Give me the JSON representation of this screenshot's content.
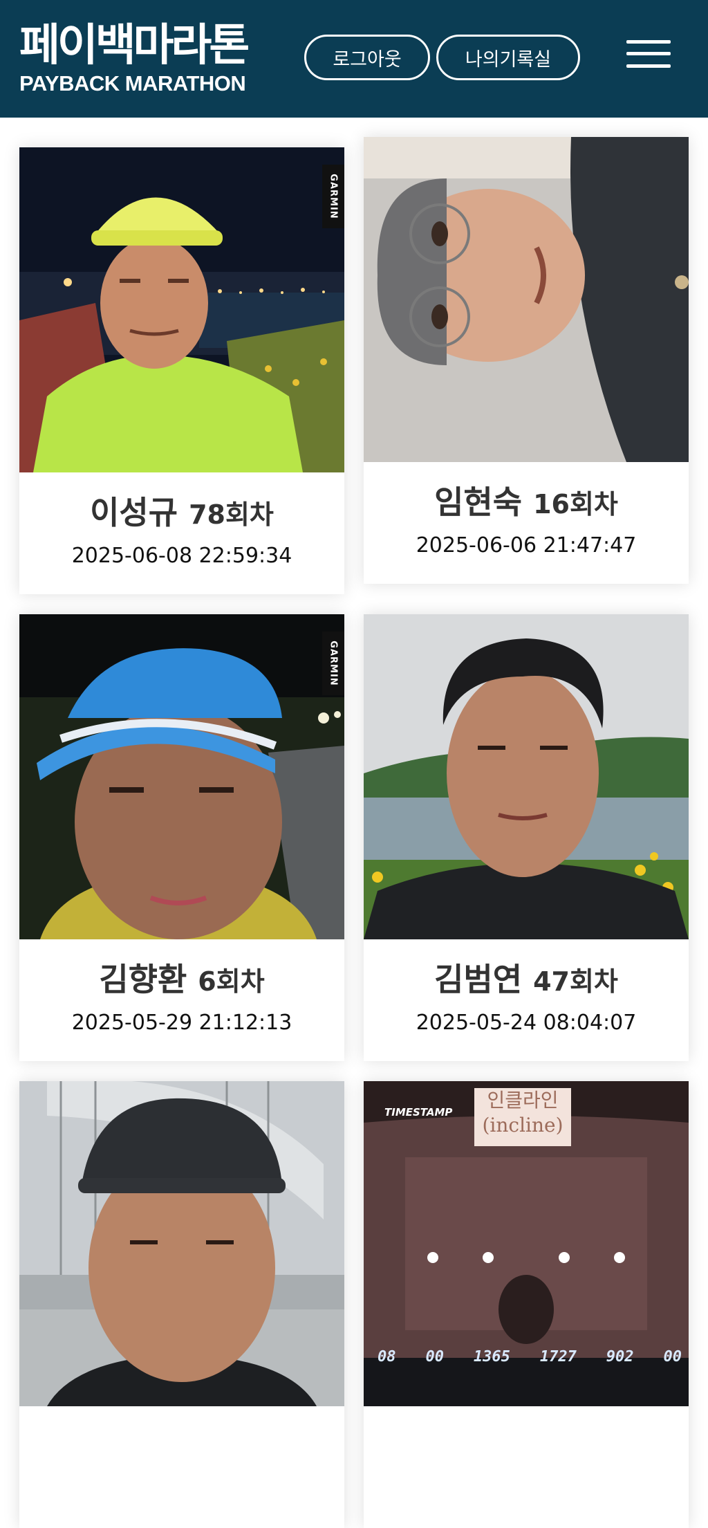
{
  "header": {
    "logo_kr": "페이백마라톤",
    "logo_en": "PAYBACK MARATHON",
    "logout_label": "로그아웃",
    "records_label": "나의기록실",
    "menu_icon": "hamburger-menu-icon",
    "background_color": "#0b3d54"
  },
  "cards": [
    {
      "name": "이성규",
      "round": "78회차",
      "date": "2025-06-08 22:59:34",
      "photo_badge": "GARMIN"
    },
    {
      "name": "임현숙",
      "round": "16회차",
      "date": "2025-06-06 21:47:47"
    },
    {
      "name": "김향환",
      "round": "6회차",
      "date": "2025-05-29 21:12:13",
      "photo_badge": "GARMIN"
    },
    {
      "name": "김범연",
      "round": "47회차",
      "date": "2025-05-24 08:04:07"
    },
    {
      "name": "",
      "round": "",
      "date": ""
    },
    {
      "name": "",
      "round": "",
      "date": "",
      "photo_sign": "인클라인",
      "photo_sign_sub": "(incline)",
      "photo_stamp": "TIMESTAMP",
      "photo_display": [
        "08",
        "00",
        "1365",
        "1727",
        "902",
        "00"
      ]
    }
  ]
}
